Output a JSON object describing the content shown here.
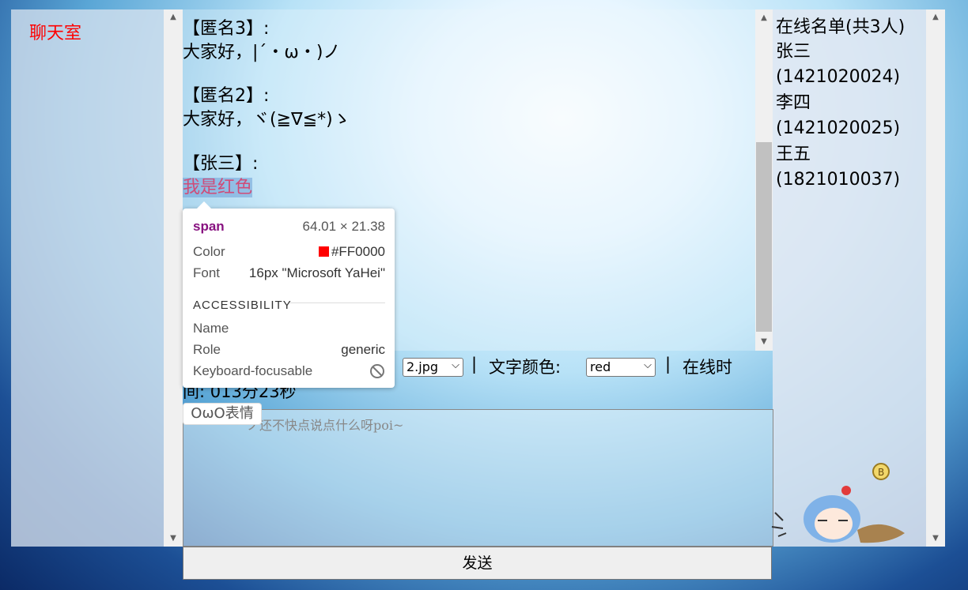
{
  "sidebar": {
    "title": "聊天室"
  },
  "messages": [
    {
      "name": "【匿名3】:",
      "text": "大家好，|´・ω・)ノ"
    },
    {
      "name": "【匿名2】:",
      "text": "大家好，ヾ(≧∇≦*)ゝ"
    },
    {
      "name": "【张三】:",
      "text": "我是红色"
    }
  ],
  "online": {
    "title": "在线名单(共3人)",
    "users": [
      {
        "name": "张三",
        "id": "(1421020024)"
      },
      {
        "name": "李四",
        "id": "(1421020025)"
      },
      {
        "name": "王五",
        "id": "(1821010037)"
      }
    ]
  },
  "toolbar": {
    "bg_value": "2.jpg",
    "separator": "|",
    "color_label": "文字颜色:",
    "color_value": "red",
    "online_time_label": "在线时",
    "online_time_value": "间: 013分23秒"
  },
  "emoji_button": "OωO表情",
  "input": {
    "placeholder": "ノ还不快点说点什么呀poi~"
  },
  "send_button": "发送",
  "tooltip": {
    "tag": "span",
    "size": "64.01 × 21.38",
    "color_label": "Color",
    "color_value": "#FF0000",
    "font_label": "Font",
    "font_value": "16px \"Microsoft YaHei\"",
    "section": "ACCESSIBILITY",
    "name_label": "Name",
    "role_label": "Role",
    "role_value": "generic",
    "focus_label": "Keyboard-focusable"
  },
  "colors": {
    "accent": "#ff0000",
    "tag_color": "#881280"
  },
  "icons": [
    "chevron-up-icon",
    "chevron-down-icon",
    "not-allowed-icon",
    "coin-icon"
  ]
}
